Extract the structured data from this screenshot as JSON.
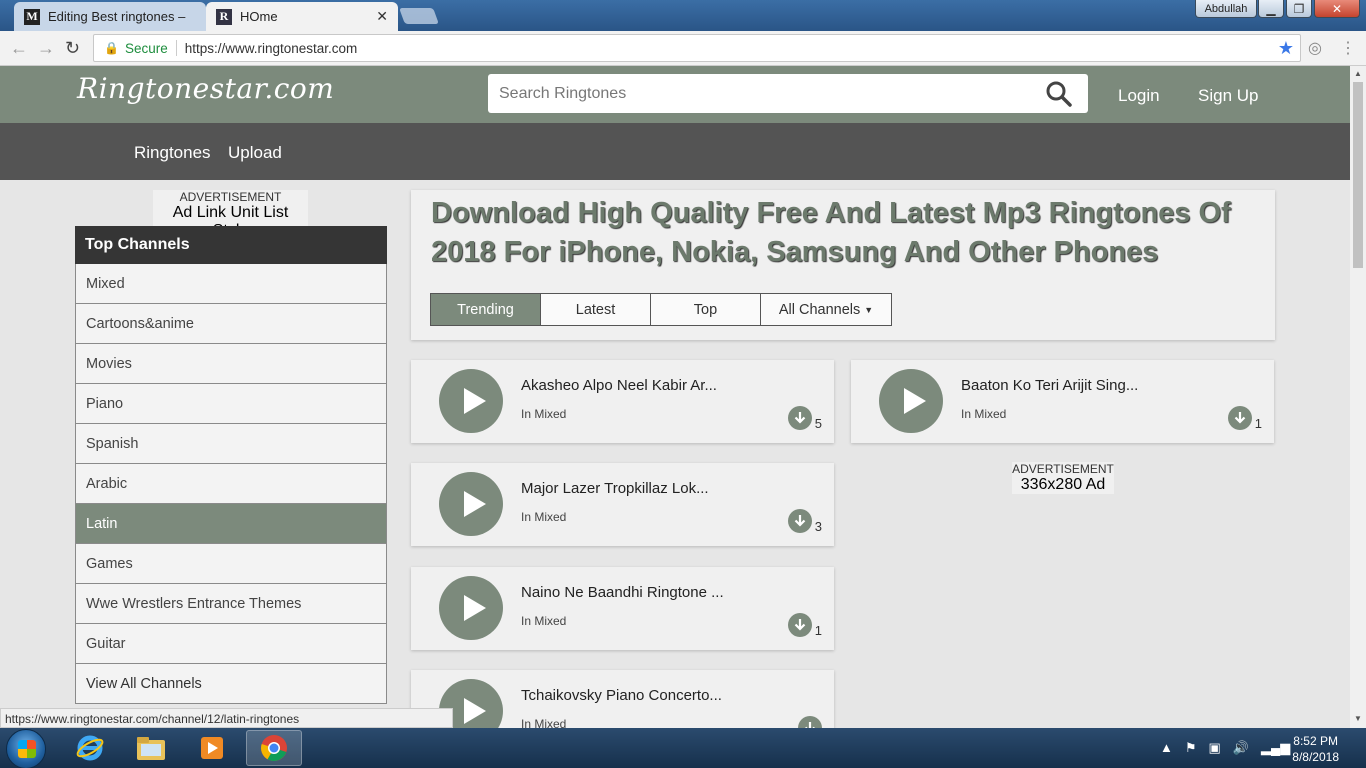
{
  "browser": {
    "tabs": [
      {
        "label": "Editing Best ringtones – ",
        "favicon": "M"
      },
      {
        "label": "HOme",
        "favicon": "R"
      }
    ],
    "user": "Abdullah",
    "secure_label": "Secure",
    "url": "https://www.ringtonestar.com",
    "status_url": "https://www.ringtonestar.com/channel/12/latin-ringtones"
  },
  "site": {
    "logo": "Ringtonestar.com",
    "search_placeholder": "Search Ringtones",
    "login": "Login",
    "signup": "Sign Up",
    "nav": [
      "Ringtones",
      "Upload"
    ]
  },
  "ad_left": {
    "label": "ADVERTISEMENT",
    "text": "Ad Link Unit List Style"
  },
  "ad_right": {
    "label": "ADVERTISEMENT",
    "text": "336x280 Ad"
  },
  "channels": {
    "heading": "Top Channels",
    "items": [
      "Mixed",
      "Cartoons&anime",
      "Movies",
      "Piano",
      "Spanish",
      "Arabic",
      "Latin",
      "Games",
      "Wwe Wrestlers Entrance Themes",
      "Guitar",
      "View All Channels"
    ],
    "active_index": 6
  },
  "hero": {
    "headline": "Download High Quality Free And Latest Mp3 Ringtones Of 2018 For iPhone, Nokia, Samsung And Other Phones",
    "tabs": [
      "Trending",
      "Latest",
      "Top",
      "All Channels"
    ],
    "active_tab": "Trending"
  },
  "ringtones": [
    {
      "title": "Akasheo Alpo Neel Kabir Ar...",
      "channel": "In Mixed",
      "downloads": "5"
    },
    {
      "title": "Baaton Ko Teri Arijit Sing...",
      "channel": "In Mixed",
      "downloads": "1"
    },
    {
      "title": "Major Lazer Tropkillaz Lok...",
      "channel": "In Mixed",
      "downloads": "3"
    },
    {
      "title": "Naino Ne Baandhi Ringtone ...",
      "channel": "In Mixed",
      "downloads": "1"
    },
    {
      "title": "Tchaikovsky Piano Concerto...",
      "channel": "In Mixed",
      "downloads": ""
    }
  ],
  "taskbar": {
    "time": "8:52 PM",
    "date": "8/8/2018"
  },
  "colors": {
    "accent": "#7c8a7c",
    "nav": "#545454",
    "dark": "#353535"
  }
}
